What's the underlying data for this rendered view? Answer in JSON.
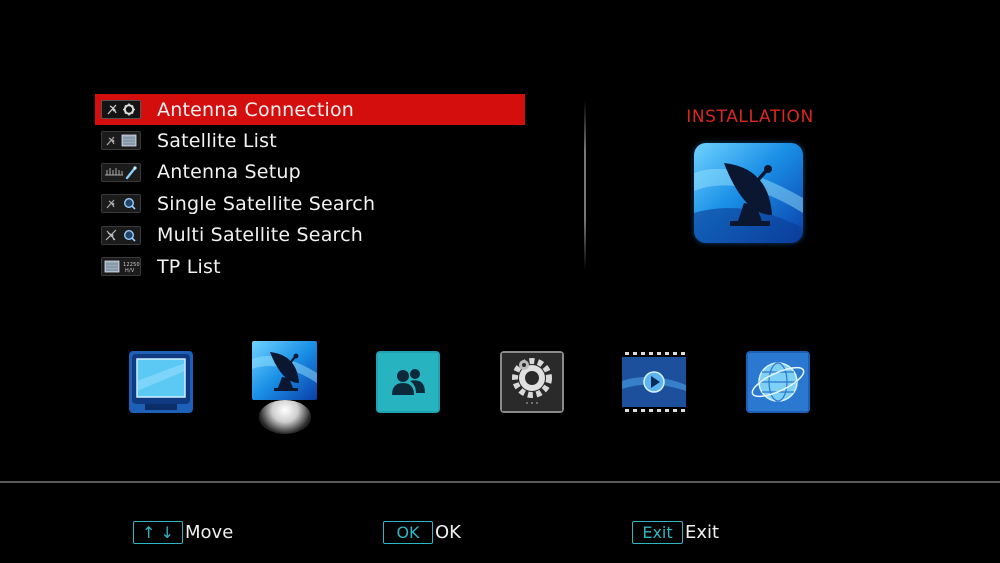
{
  "menu": {
    "items": [
      {
        "label": "Antenna Connection",
        "icon": "antenna-connection-icon",
        "selected": true
      },
      {
        "label": "Satellite List",
        "icon": "satellite-list-icon",
        "selected": false
      },
      {
        "label": "Antenna Setup",
        "icon": "antenna-setup-icon",
        "selected": false
      },
      {
        "label": "Single Satellite Search",
        "icon": "single-satellite-search-icon",
        "selected": false
      },
      {
        "label": "Multi Satellite Search",
        "icon": "multi-satellite-search-icon",
        "selected": false
      },
      {
        "label": "TP List",
        "icon": "tp-list-icon",
        "selected": false,
        "icon_text": [
          "12250",
          "H/V"
        ]
      }
    ]
  },
  "section": {
    "title": "INSTALLATION",
    "icon": "satellite-dish-icon"
  },
  "app_bar": {
    "active_index": 1,
    "items": [
      {
        "name": "tv-icon"
      },
      {
        "name": "installation-icon"
      },
      {
        "name": "users-icon"
      },
      {
        "name": "settings-gear-icon"
      },
      {
        "name": "media-player-icon"
      },
      {
        "name": "network-globe-icon"
      }
    ]
  },
  "hints": [
    {
      "key": "↑ ↓",
      "label": "Move"
    },
    {
      "key": "OK",
      "label": "OK"
    },
    {
      "key": "Exit",
      "label": "Exit"
    }
  ],
  "colors": {
    "selection": "#d40d0d",
    "title": "#d8281f",
    "key_border": "#2fb6c3",
    "background": "#000000"
  }
}
